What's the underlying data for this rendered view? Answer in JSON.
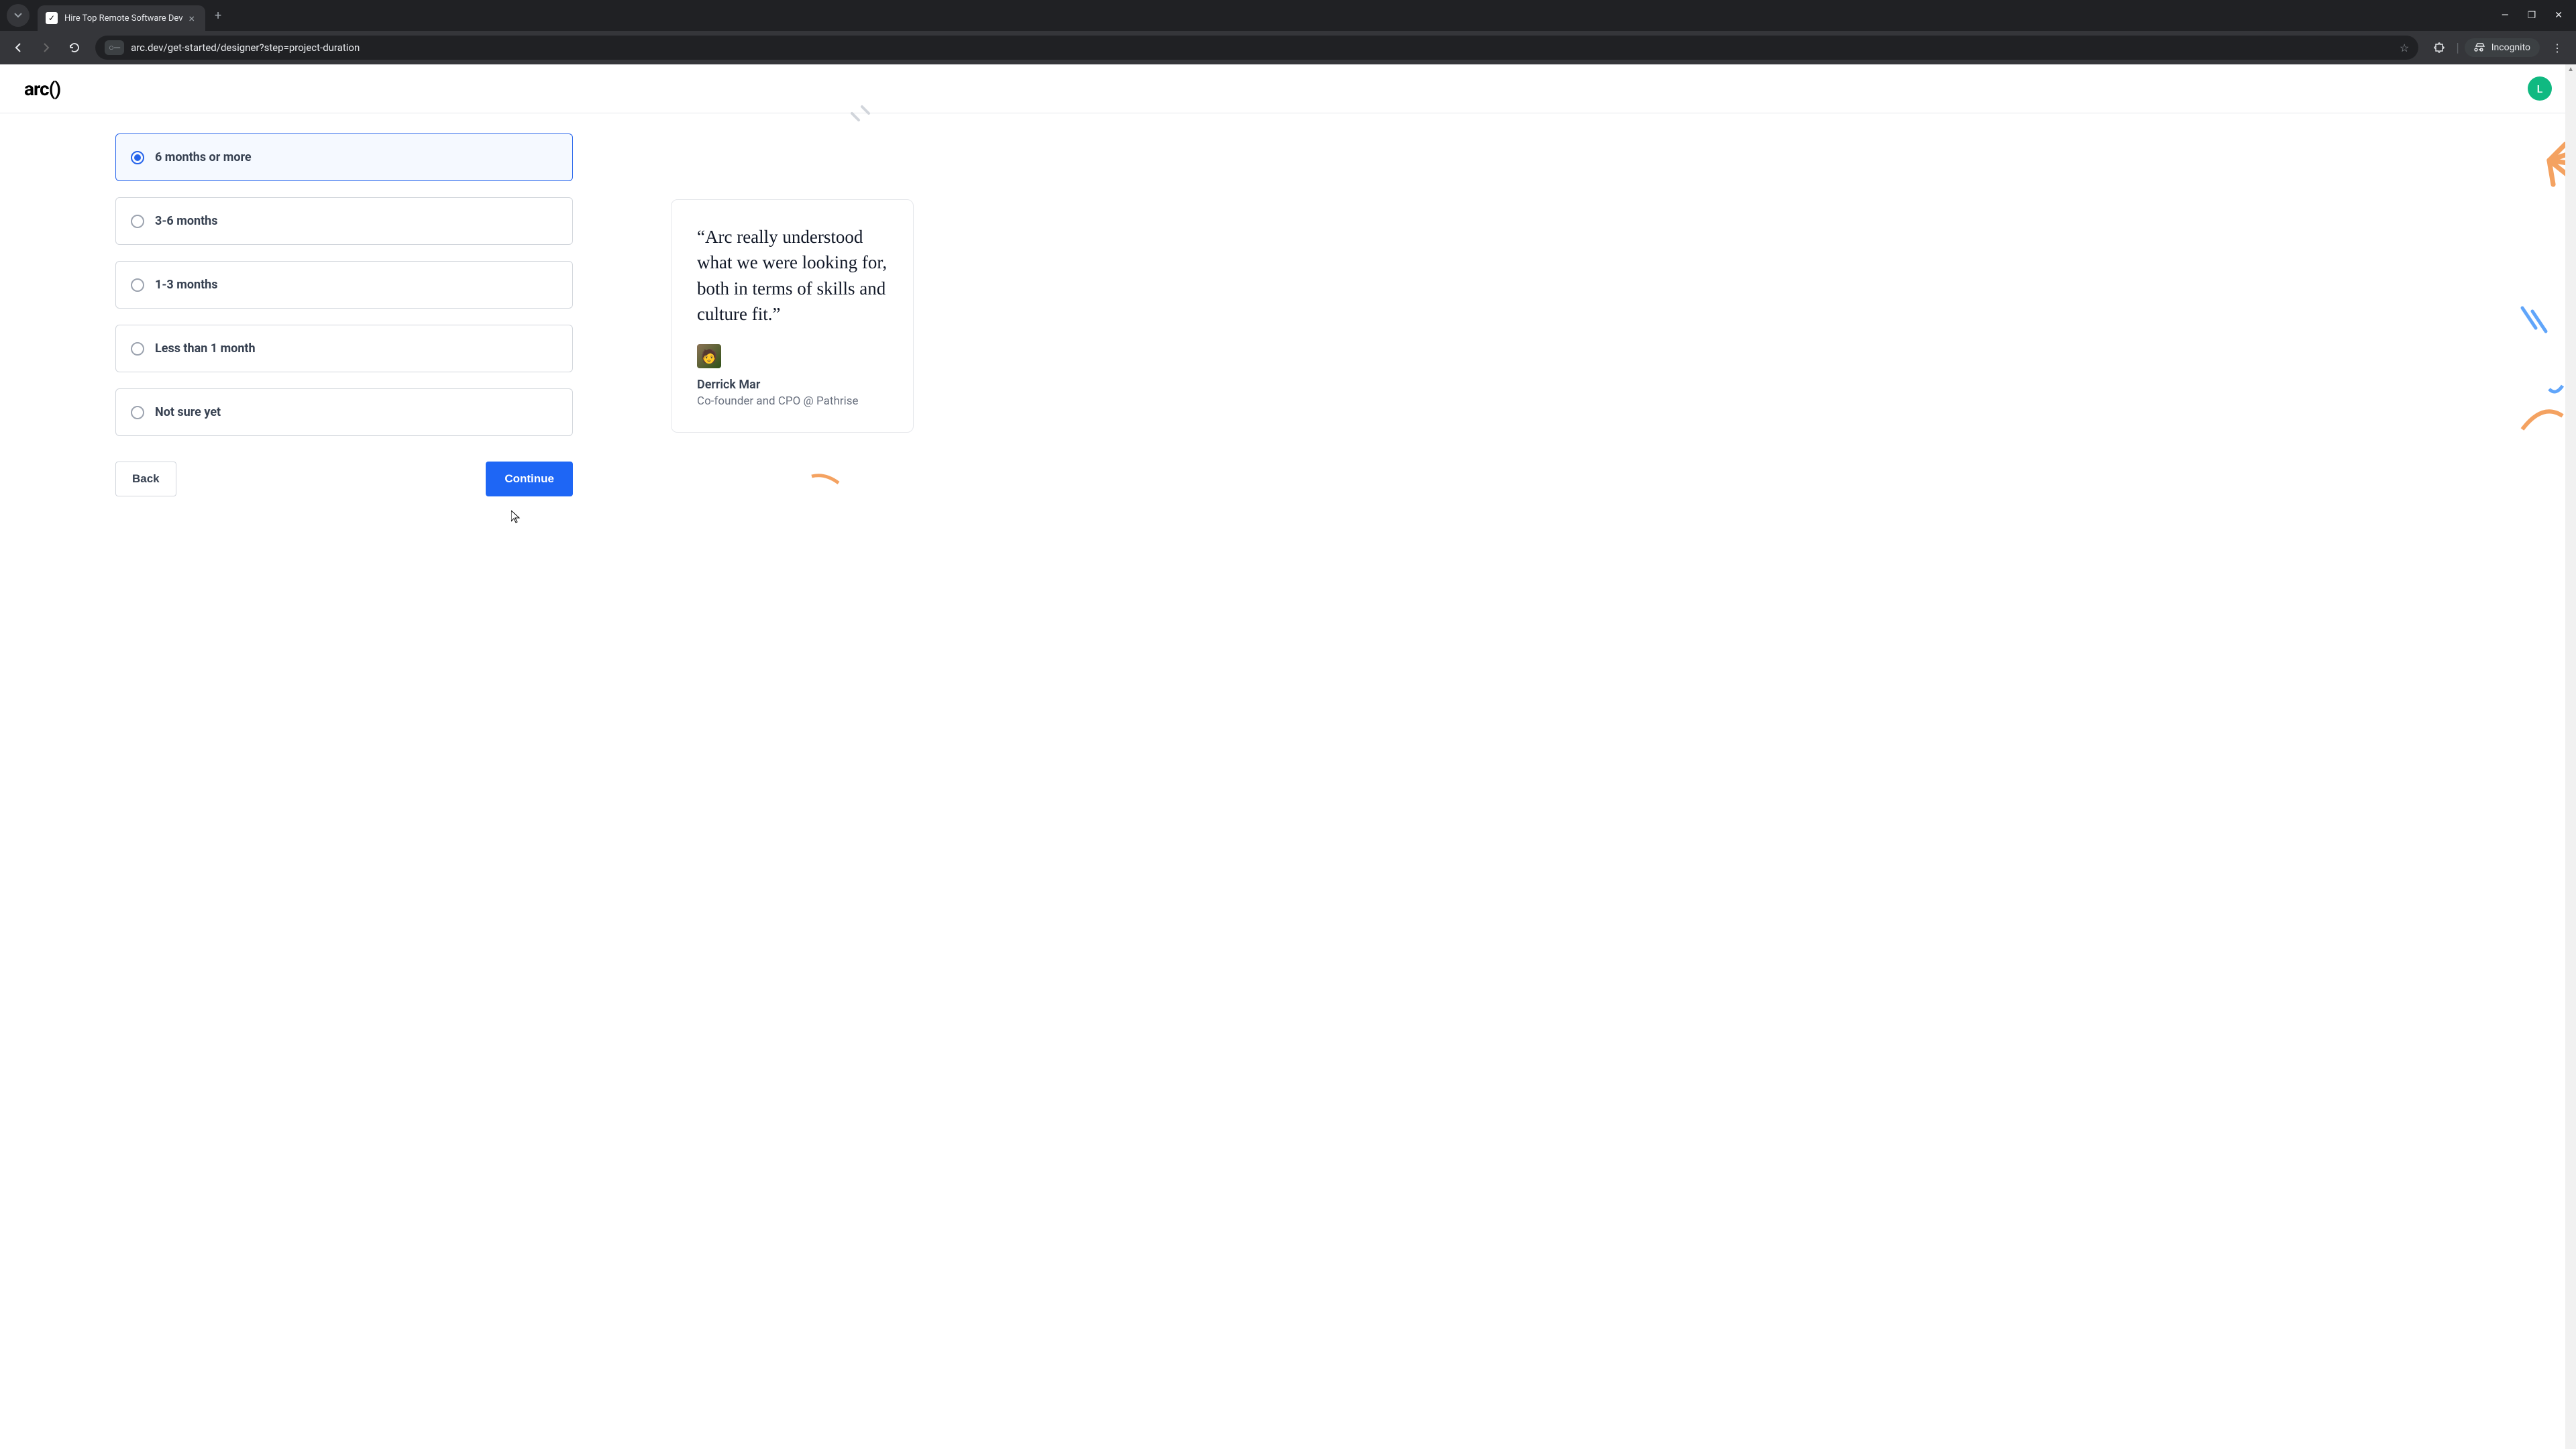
{
  "browser": {
    "tab_title": "Hire Top Remote Software Dev",
    "url": "arc.dev/get-started/designer?step=project-duration",
    "incognito_label": "Incognito"
  },
  "header": {
    "logo": "arc()",
    "avatar_initial": "L"
  },
  "form": {
    "options": [
      {
        "label": "6 months or more",
        "selected": true
      },
      {
        "label": "3-6 months",
        "selected": false
      },
      {
        "label": "1-3 months",
        "selected": false
      },
      {
        "label": "Less than 1 month",
        "selected": false
      },
      {
        "label": "Not sure yet",
        "selected": false
      }
    ],
    "back_label": "Back",
    "continue_label": "Continue"
  },
  "testimonial": {
    "quote": "“Arc really understood what we were looking for, both in terms of skills and culture fit.”",
    "name": "Derrick Mar",
    "title": "Co-founder and CPO @ Pathrise"
  }
}
